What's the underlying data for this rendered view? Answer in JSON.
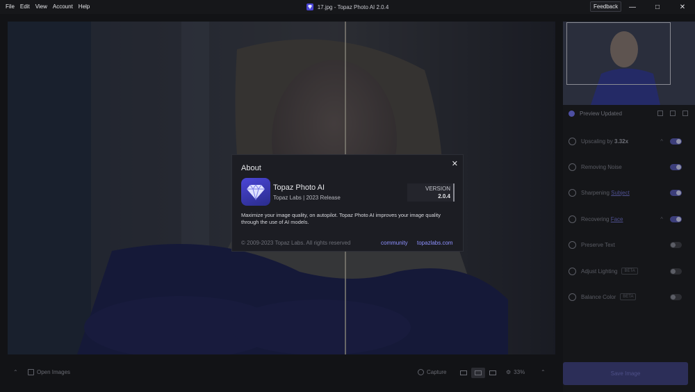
{
  "menu": [
    "File",
    "Edit",
    "View",
    "Account",
    "Help"
  ],
  "window": {
    "title": "17.jpg - Topaz Photo AI 2.0.4",
    "feedback_label": "Feedback"
  },
  "panel": {
    "preview_label": "Preview Updated",
    "features": [
      {
        "prefix": "Upscaling by ",
        "bold": "3.32x",
        "underline": "",
        "beta": "",
        "chev": "^",
        "on": true
      },
      {
        "prefix": "Removing Noise",
        "bold": "",
        "underline": "",
        "beta": "",
        "chev": "",
        "on": true
      },
      {
        "prefix": "Sharpening ",
        "bold": "",
        "underline": "Subject",
        "beta": "",
        "chev": "",
        "on": true
      },
      {
        "prefix": "Recovering ",
        "bold": "",
        "underline": "Face",
        "beta": "",
        "chev": "^",
        "on": true
      },
      {
        "prefix": "Preserve Text",
        "bold": "",
        "underline": "",
        "beta": "",
        "chev": "",
        "on": false
      },
      {
        "prefix": "Adjust Lighting",
        "bold": "",
        "underline": "",
        "beta": "BETA",
        "chev": "",
        "on": false
      },
      {
        "prefix": "Balance Color",
        "bold": "",
        "underline": "",
        "beta": "BETA",
        "chev": "",
        "on": false
      }
    ],
    "save_label": "Save Image"
  },
  "bottom": {
    "open_images": "Open Images",
    "capture": "Capture",
    "zoom": "33%"
  },
  "about": {
    "title": "About",
    "product": "Topaz Photo AI",
    "company_line": "Topaz Labs | 2023 Release",
    "version_label": "VERSION",
    "version": "2.0.4",
    "description": "Maximize your image quality, on autopilot. Topaz Photo AI improves your image quality through the use of AI models.",
    "copyright": "© 2009-2023 Topaz Labs. All rights reserved",
    "link_community": "community",
    "link_site": "topazlabs.com"
  },
  "colors": {
    "accent": "#8e91ff",
    "logo": "#4b46d6",
    "toggle_on": "#3c3e7a"
  }
}
